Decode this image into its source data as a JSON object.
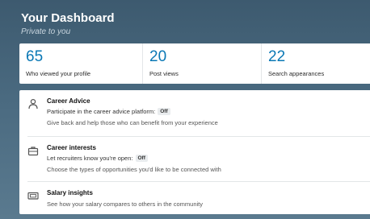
{
  "header": {
    "title": "Your Dashboard",
    "subtitle": "Private to you"
  },
  "stats": [
    {
      "number": "65",
      "label": "Who viewed your profile"
    },
    {
      "number": "20",
      "label": "Post views"
    },
    {
      "number": "22",
      "label": "Search appearances"
    }
  ],
  "items": [
    {
      "title": "Career Advice",
      "line_text": "Participate in the career advice platform:",
      "badge": "Off",
      "description": "Give back and help those who can benefit from your experience",
      "icon": "person-icon"
    },
    {
      "title": "Career interests",
      "line_text": "Let recruiters know you're open:",
      "badge": "Off",
      "description": "Choose the types of opportunities you'd like to be connected with",
      "icon": "briefcase-icon"
    },
    {
      "title": "Salary insights",
      "description": "See how your salary compares to others in the community",
      "icon": "money-icon"
    }
  ],
  "colors": {
    "header_bg": "#4a6a80",
    "accent": "#0a78b5"
  }
}
